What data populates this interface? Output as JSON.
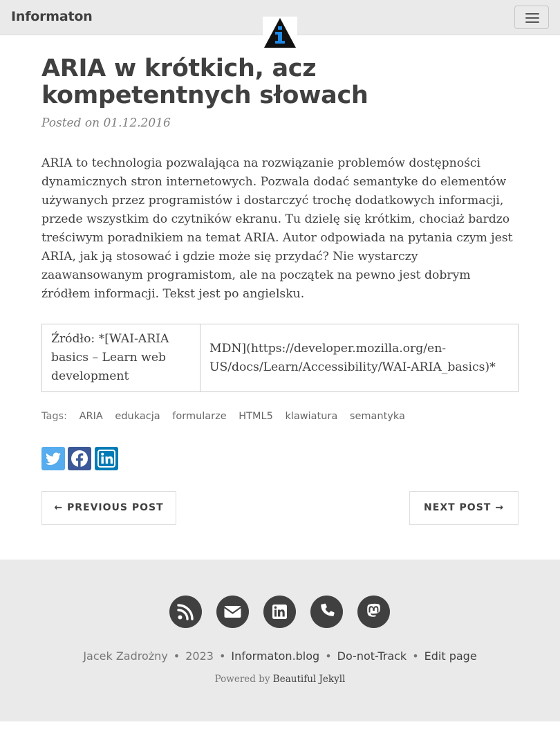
{
  "navbar": {
    "brand": "Informaton",
    "menu_icon": "hamburger-icon",
    "logo_icon": "info-triangle-logo",
    "colors": {
      "background": "#eaeaea",
      "logo_accent": "#1e88e5"
    }
  },
  "post": {
    "title": "ARIA w krótkich, acz kompetentnych słowach",
    "meta": "Posted on 01.12.2016",
    "body": "ARIA to technologia pozwalająca na rozwiązanie problemów dostępności dynamicznych stron internetowych. Pozwala dodać semantyke do elementów używanych przez programistów i dostarczyć trochę dodatkowych informacji, przede wszystkim do czytników ekranu. Tu dzielę się krótkim, chociaż bardzo treściwym poradnikiem na temat ARIA. Autor odpowiada na pytania czym jest ARIA, jak ją stosować i gdzie może się przydać? Nie wystarczy zaawansowanym programistom, ale na początek na pewno jest dobrym źródłem informacji. Tekst jest po angielsku.",
    "source_table": {
      "cell_1": "Źródło: *[WAI-ARIA basics – Learn web development",
      "cell_2": "MDN](https://developer.mozilla.org/en-US/docs/Learn/Accessibility/WAI-ARIA_basics)*"
    },
    "tags_label": "Tags:",
    "tags": [
      "ARIA",
      "edukacja",
      "formularze",
      "HTML5",
      "klawiatura",
      "semantyka"
    ],
    "share": [
      {
        "icon": "twitter-icon",
        "color": "#55acee"
      },
      {
        "icon": "facebook-icon",
        "color": "#3b5998"
      },
      {
        "icon": "linkedin-icon",
        "color": "#007bb5"
      }
    ],
    "pager": {
      "previous": "← PREVIOUS POST",
      "next": "NEXT POST →"
    }
  },
  "footer": {
    "social_icons": [
      "rss-icon",
      "envelope-icon",
      "linkedin-icon",
      "phone-icon",
      "mastodon-icon"
    ],
    "author": "Jacek Zadrożny",
    "year": "2023",
    "links": [
      "Informaton.blog",
      "Do-not-Track",
      "Edit page"
    ],
    "powered_prefix": "Powered by",
    "powered_link": "Beautiful Jekyll",
    "colors": {
      "background": "#eaeaea",
      "icon_circle": "#404040"
    }
  }
}
